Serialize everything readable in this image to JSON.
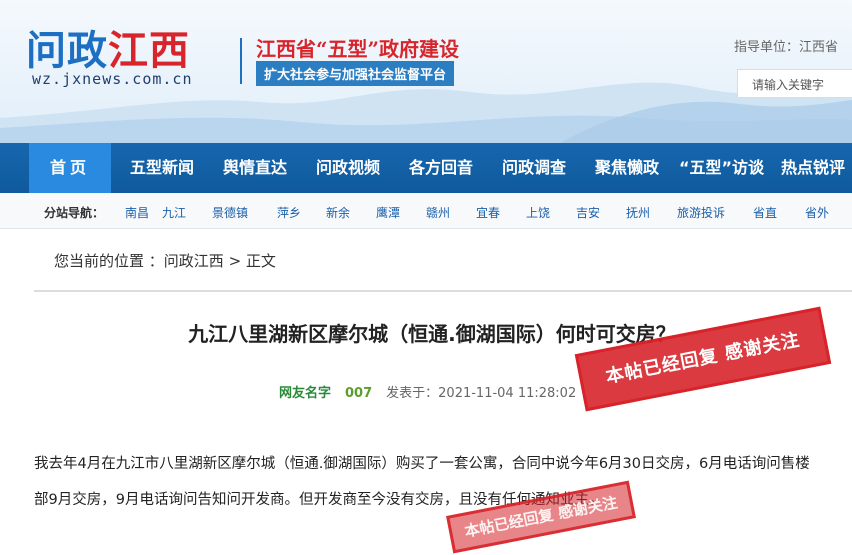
{
  "header": {
    "logo_main": "问政",
    "logo_accent": "江西",
    "logo_url": "wz.jxnews.com.cn",
    "slogan_title": "江西省“五型”政府建设",
    "slogan_sub": "扩大社会参与加强社会监督平台",
    "guide_text": "指导单位：江西省",
    "search_placeholder": "请输入关键字"
  },
  "nav": {
    "items": [
      "首页",
      "五型新闻",
      "舆情直达",
      "问政视频",
      "各方回音",
      "问政调查",
      "聚焦懒政",
      "“五型”访谈",
      "热点锐评"
    ]
  },
  "subnav": {
    "label": "分站导航：",
    "items": [
      "南昌",
      "九江",
      "景德镇",
      "萍乡",
      "新余",
      "鹰潭",
      "赣州",
      "宜春",
      "上饶",
      "吉安",
      "抚州",
      "旅游投诉",
      "省直",
      "省外"
    ]
  },
  "breadcrumb": {
    "prefix": "您当前的位置 ：",
    "link": "问政江西",
    "sep": " > ",
    "current": "正文"
  },
  "article": {
    "title": "九江八里湖新区摩尔城（恒通.御湖国际）何时可交房？",
    "author": "网友名字",
    "count": "007",
    "time": "发表于：2021-11-04 11:28:02",
    "body": "我去年4月在九江市八里湖新区摩尔城（恒通.御湖国际）购买了一套公寓，合同中说今年6月30日交房，6月电话询问售楼部9月交房，9月电话询问告知问开发商。但开发商至今没有交房，且没有任何通知业主。"
  },
  "stamps": {
    "big": "本帖已经回复 感谢关注",
    "small": "本帖已经回复 感谢关注"
  },
  "colors": {
    "nav_bg": "#1766ae",
    "nav_active": "#2a8ae0",
    "brand_red": "#d8252b",
    "brand_blue": "#1d6fc3"
  }
}
